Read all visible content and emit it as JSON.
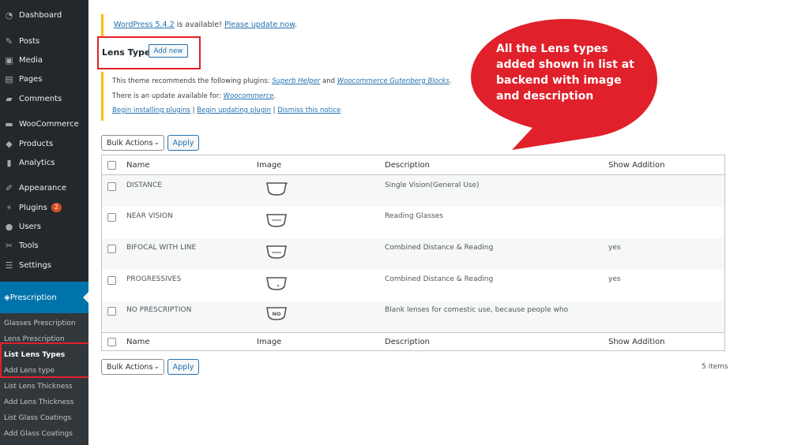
{
  "sidebar": {
    "items": [
      {
        "label": "Dashboard",
        "icon": "dashboard-icon"
      },
      {
        "label": "Posts",
        "icon": "pin-icon"
      },
      {
        "label": "Media",
        "icon": "media-icon"
      },
      {
        "label": "Pages",
        "icon": "pages-icon"
      },
      {
        "label": "Comments",
        "icon": "comment-icon"
      },
      {
        "label": "WooCommerce",
        "icon": "woocommerce-icon"
      },
      {
        "label": "Products",
        "icon": "box-icon"
      },
      {
        "label": "Analytics",
        "icon": "bar-chart-icon"
      },
      {
        "label": "Appearance",
        "icon": "brush-icon"
      },
      {
        "label": "Plugins",
        "icon": "plug-icon",
        "badge": "2"
      },
      {
        "label": "Users",
        "icon": "user-icon"
      },
      {
        "label": "Tools",
        "icon": "wrench-icon"
      },
      {
        "label": "Settings",
        "icon": "sliders-icon"
      }
    ],
    "active": {
      "label": "Prescription",
      "icon": "tag-icon"
    },
    "submenu": [
      "Glasses Prescription",
      "Lens Prescription",
      "List Lens Types",
      "Add Lens type",
      "List Lens Thickness",
      "Add Lens Thickness",
      "List Glass Coatings",
      "Add Glass Coatings"
    ]
  },
  "update_notice": {
    "version_link": "WordPress 5.4.2",
    "text": " is available! ",
    "update_link": "Please update now",
    "end": "."
  },
  "page": {
    "title": "Lens Type",
    "add_new": "Add new"
  },
  "plugin_notice": {
    "line1_prefix": "This theme recommends the following plugins: ",
    "plugin1": "Superb Helper",
    "and": " and ",
    "plugin2": "Woocommerce Gutenberg Blocks",
    "line1_end": ".",
    "line2_prefix": "There is an update available for: ",
    "plugin3": "Woocommerce",
    "line2_end": ".",
    "action1": "Begin installing plugins",
    "sep": " | ",
    "action2": "Begin updating plugin",
    "action3": "Dismiss this notice"
  },
  "bulk_actions": {
    "label": "Bulk Actions",
    "apply": "Apply"
  },
  "table": {
    "headers": [
      "Name",
      "Image",
      "Description",
      "Show Addition"
    ],
    "rows": [
      {
        "name": "DISTANCE",
        "description": "Single Vision(General Use)",
        "show_addition": "",
        "icon_text": ""
      },
      {
        "name": "NEAR VISION",
        "description": "Reading Glasses",
        "show_addition": "",
        "icon_text": ""
      },
      {
        "name": "BIFOCAL WITH LINE",
        "description": "Combined Distance & Reading",
        "show_addition": "yes",
        "icon_text": ""
      },
      {
        "name": "PROGRESSIVES",
        "description": "Combined Distance & Reading",
        "show_addition": "yes",
        "icon_text": ""
      },
      {
        "name": "NO PRESCRIPTION",
        "description": "Blank lenses for comestic use, because people who",
        "show_addition": "",
        "icon_text": "NO"
      }
    ],
    "item_count": "5 items"
  },
  "callout": {
    "lines": [
      "All the Lens types",
      "added shown in list at",
      "backend with image",
      "and description"
    ],
    "color": "#e0202a"
  },
  "colors": {
    "accent": "#0073aa",
    "sidebar": "#23282d",
    "highlight": "#e0202a"
  }
}
